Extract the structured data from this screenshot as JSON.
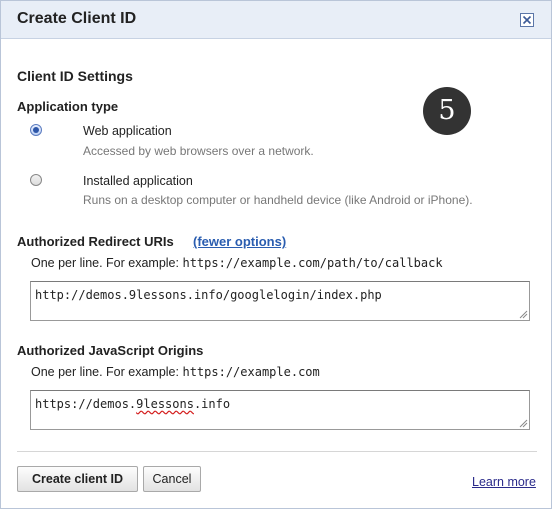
{
  "dialog": {
    "title": "Create Client ID",
    "close_icon": "close-icon"
  },
  "settings": {
    "heading": "Client ID Settings",
    "step_badge": "5"
  },
  "application_type": {
    "label": "Application type",
    "options": [
      {
        "label": "Web application",
        "description": "Accessed by web browsers over a network.",
        "selected": true
      },
      {
        "label": "Installed application",
        "description": "Runs on a desktop computer or handheld device (like Android or iPhone).",
        "selected": false
      }
    ]
  },
  "redirect_uris": {
    "label": "Authorized Redirect URIs",
    "toggle_link": "(fewer options)",
    "hint_prefix": "One per line. For example:",
    "hint_example": "https://example.com/path/to/callback",
    "value": "http://demos.9lessons.info/googlelogin/index.php"
  },
  "js_origins": {
    "label": "Authorized JavaScript Origins",
    "hint_prefix": "One per line. For example:",
    "hint_example": "https://example.com",
    "value_before": "https://demos.",
    "value_misspelled": "9lessons",
    "value_after": ".info"
  },
  "footer": {
    "create_label": "Create client ID",
    "cancel_label": "Cancel",
    "learn_more": "Learn more"
  }
}
